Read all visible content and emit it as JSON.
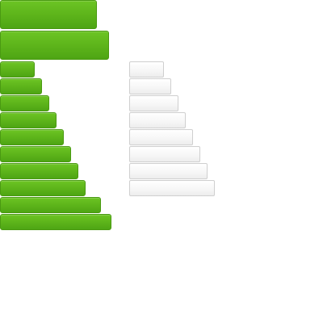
{
  "colors": {
    "green_button_fill": "#5cb31a",
    "green_button_border": "#4a9a12",
    "white_button_fill": "#f6f6f6",
    "white_button_border": "#cfcfcf",
    "background": "#ffffff"
  },
  "green_buttons_large": [
    {
      "label": ""
    },
    {
      "label": ""
    }
  ],
  "green_buttons_small": [
    {
      "label": ""
    },
    {
      "label": ""
    },
    {
      "label": ""
    },
    {
      "label": ""
    },
    {
      "label": ""
    },
    {
      "label": ""
    },
    {
      "label": ""
    },
    {
      "label": ""
    },
    {
      "label": ""
    },
    {
      "label": ""
    }
  ],
  "white_buttons": [
    {
      "label": ""
    },
    {
      "label": ""
    },
    {
      "label": ""
    },
    {
      "label": ""
    },
    {
      "label": ""
    },
    {
      "label": ""
    },
    {
      "label": ""
    },
    {
      "label": ""
    }
  ]
}
